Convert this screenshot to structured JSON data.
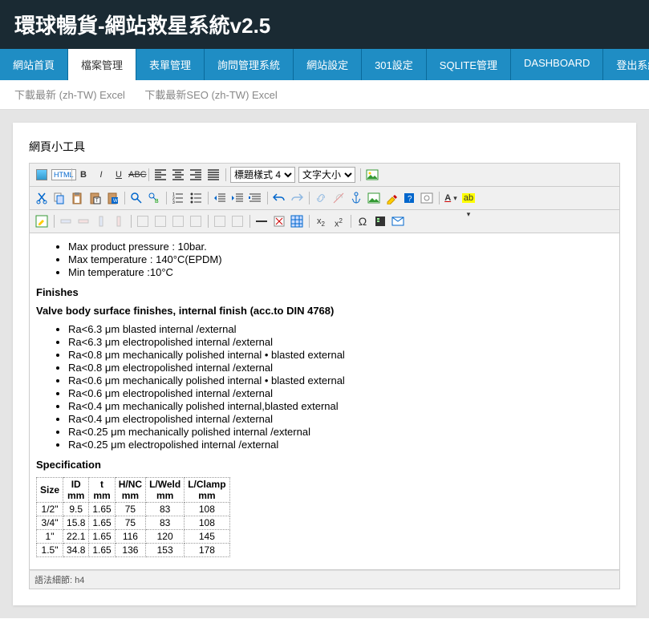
{
  "header": {
    "title": "環球暢貨-網站救星系統v2.5"
  },
  "nav": {
    "items": [
      {
        "label": "網站首頁"
      },
      {
        "label": "檔案管理",
        "active": true
      },
      {
        "label": "表單管理"
      },
      {
        "label": "詢問管理系統"
      },
      {
        "label": "網站設定"
      },
      {
        "label": "301設定"
      },
      {
        "label": "SQLITE管理"
      },
      {
        "label": "DASHBOARD"
      },
      {
        "label": "登出系統"
      }
    ]
  },
  "subnav": {
    "link1": "下載最新 (zh-TW) Excel",
    "link2": "下載最新SEO (zh-TW) Excel"
  },
  "editor": {
    "section_label": "網頁小工具",
    "html_btn": "HTML",
    "heading_select": "標題樣式 4",
    "fontsize_select": "文字大小",
    "status": "語法細節: h4"
  },
  "content": {
    "bullets1": [
      "Max product pressure : 10bar.",
      "Max temperature : 140°C(EPDM)",
      "Min temperature :10°C"
    ],
    "h_finishes": "Finishes",
    "h_valve": "Valve body surface finishes, internal finish (acc.to DIN 4768)",
    "bullets2": [
      "Ra<6.3 μm blasted internal /external",
      "Ra<6.3 μm electropolished internal /external",
      "Ra<0.8 μm mechanically polished internal • blasted external",
      "Ra<0.8 μm electropolished internal /external",
      "Ra<0.6 μm mechanically polished internal • blasted external",
      "Ra<0.6 μm electropolished internal /external",
      "Ra<0.4 μm mechanically polished internal,blasted external",
      "Ra<0.4 μm electropolished internal /external",
      "Ra<0.25 μm mechanically polished internal /external",
      "Ra<0.25 μm electropolished internal /external"
    ],
    "h_spec": "Specification"
  },
  "chart_data": {
    "type": "table",
    "columns": [
      "Size",
      "ID mm",
      "t mm",
      "H/NC mm",
      "L/Weld mm",
      "L/Clamp mm"
    ],
    "rows": [
      [
        "1/2\"",
        "9.5",
        "1.65",
        "75",
        "83",
        "108"
      ],
      [
        "3/4\"",
        "15.8",
        "1.65",
        "75",
        "83",
        "108"
      ],
      [
        "1\"",
        "22.1",
        "1.65",
        "116",
        "120",
        "145"
      ],
      [
        "1.5\"",
        "34.8",
        "1.65",
        "136",
        "153",
        "178"
      ]
    ]
  }
}
